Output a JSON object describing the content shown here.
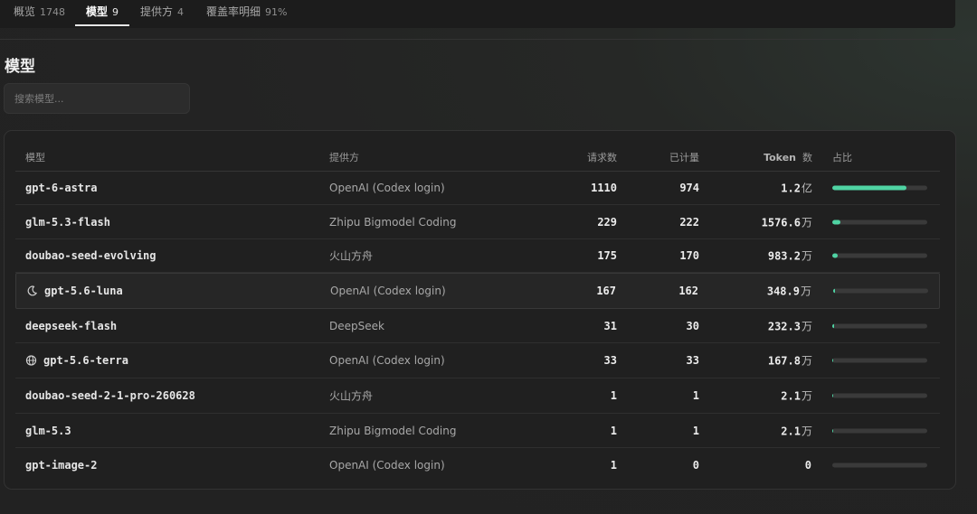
{
  "tabs": [
    {
      "label": "概览",
      "count": "1748",
      "active": false
    },
    {
      "label": "模型",
      "count": "9",
      "active": true
    },
    {
      "label": "提供方",
      "count": "4",
      "active": false
    },
    {
      "label": "覆盖率明细",
      "count": "91%",
      "active": false
    }
  ],
  "page_title": "模型",
  "search": {
    "placeholder": "搜索模型...",
    "value": ""
  },
  "table": {
    "headers": {
      "model": "模型",
      "provider": "提供方",
      "requests": "请求数",
      "billed": "已计量",
      "tokens_label": "Token",
      "tokens_unit": "数",
      "share": "占比"
    },
    "rows": [
      {
        "model": "gpt-6-astra",
        "icon": null,
        "provider": "OpenAI (Codex login)",
        "requests": "1110",
        "billed": "974",
        "tokens": "1.2",
        "tokens_unit": "亿",
        "share": 0.78,
        "highlighted": false
      },
      {
        "model": "glm-5.3-flash",
        "icon": null,
        "provider": "Zhipu Bigmodel Coding",
        "requests": "229",
        "billed": "222",
        "tokens": "1576.6",
        "tokens_unit": "万",
        "share": 0.09,
        "highlighted": false
      },
      {
        "model": "doubao-seed-evolving",
        "icon": null,
        "provider": "火山方舟",
        "requests": "175",
        "billed": "170",
        "tokens": "983.2",
        "tokens_unit": "万",
        "share": 0.055,
        "highlighted": false
      },
      {
        "model": "gpt-5.6-luna",
        "icon": "moon-icon",
        "provider": "OpenAI (Codex login)",
        "requests": "167",
        "billed": "162",
        "tokens": "348.9",
        "tokens_unit": "万",
        "share": 0.02,
        "highlighted": true
      },
      {
        "model": "deepseek-flash",
        "icon": null,
        "provider": "DeepSeek",
        "requests": "31",
        "billed": "30",
        "tokens": "232.3",
        "tokens_unit": "万",
        "share": 0.015,
        "highlighted": false
      },
      {
        "model": "gpt-5.6-terra",
        "icon": "globe-icon",
        "provider": "OpenAI (Codex login)",
        "requests": "33",
        "billed": "33",
        "tokens": "167.8",
        "tokens_unit": "万",
        "share": 0.01,
        "highlighted": false
      },
      {
        "model": "doubao-seed-2-1-pro-260628",
        "icon": null,
        "provider": "火山方舟",
        "requests": "1",
        "billed": "1",
        "tokens": "2.1",
        "tokens_unit": "万",
        "share": 0.001,
        "highlighted": false
      },
      {
        "model": "glm-5.3",
        "icon": null,
        "provider": "Zhipu Bigmodel Coding",
        "requests": "1",
        "billed": "1",
        "tokens": "2.1",
        "tokens_unit": "万",
        "share": 0.001,
        "highlighted": false
      },
      {
        "model": "gpt-image-2",
        "icon": null,
        "provider": "OpenAI (Codex login)",
        "requests": "1",
        "billed": "0",
        "tokens": "0",
        "tokens_unit": "",
        "share": 0.0,
        "highlighted": false
      }
    ]
  },
  "colors": {
    "accent": "#4fd3a3",
    "bar_track": "#3a3a3a",
    "background": "#222222",
    "card": "#202020"
  }
}
